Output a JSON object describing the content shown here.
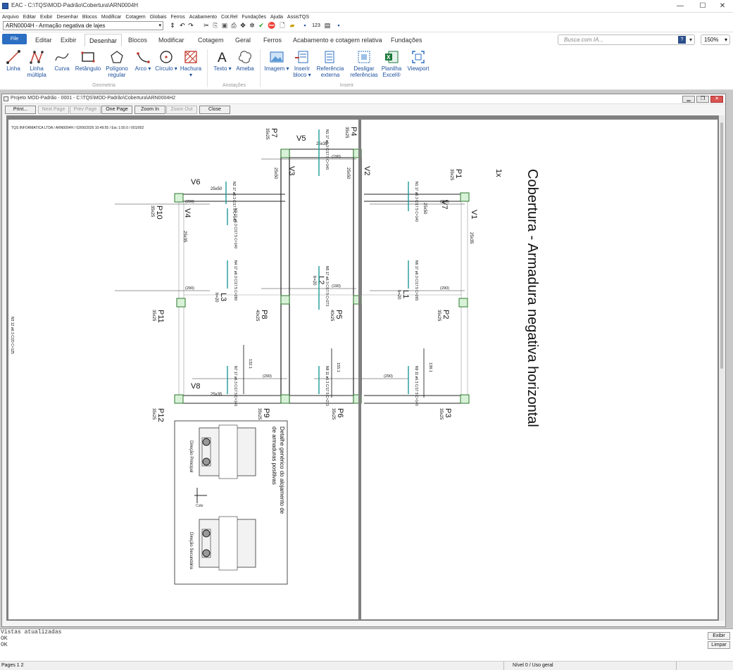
{
  "window": {
    "title": "EAC - C:\\TQS\\MOD-Padrão\\Cobertura\\ARN0004H",
    "controls": [
      "—",
      "☐",
      "✕"
    ]
  },
  "menu": [
    "Arquivo",
    "Editar",
    "Exibir",
    "Desenhar",
    "Blocos",
    "Modificar",
    "Cotagem",
    "Globais",
    "Ferros",
    "Acabamento",
    "Cot.Rel",
    "Fundações",
    "Ajuda",
    "AssisTQS"
  ],
  "quick_access": {
    "document": "ARN0004H - Armação negativa de lajes"
  },
  "tabs": {
    "file": "File",
    "items": [
      "Editar",
      "Exibir",
      "Desenhar",
      "Blocos",
      "Modificar",
      "Cotagem",
      "Geral",
      "Ferros",
      "Acabamento e cotagem relativa",
      "Fundações"
    ],
    "active": "Desenhar"
  },
  "search": {
    "placeholder": "Busca com IA...",
    "help": "?"
  },
  "zoom": "150%",
  "ribbon": {
    "buttons": [
      {
        "label": "Linha"
      },
      {
        "label": "Linha múltipla"
      },
      {
        "label": "Curva"
      },
      {
        "label": "Retângulo"
      },
      {
        "label": "Polígono regular"
      },
      {
        "label": "Arco ▾"
      },
      {
        "label": "Círculo ▾"
      },
      {
        "label": "Hachura ▾"
      },
      {
        "label": "Texto ▾"
      },
      {
        "label": "Ameba"
      },
      {
        "label": "Imagem ▾"
      },
      {
        "label": "Inserir bloco ▾"
      },
      {
        "label": "Referência externa"
      },
      {
        "label": "Desligar referências"
      },
      {
        "label": "Planilha Excel®"
      },
      {
        "label": "Viewport"
      }
    ],
    "groups": [
      "Geometria",
      "Anotações",
      "Inserir"
    ]
  },
  "child_window": {
    "title": "Projeto MOD-Padrão - 0001 - C:\\TQS\\MOD-Padrão\\Cobertura\\ARN0004H2",
    "toolbar": [
      "Print...",
      "Next Page",
      "Prev Page",
      "One Page",
      "Zoom In",
      "Zoom Out",
      "Close"
    ]
  },
  "drawing": {
    "header": "TQS INFORMATICA LTDA / ARN0004H / 02/06/2026 10:49:55 / Esc 1:50.0 / 001/002",
    "big_title": "Cobertura - Armadura negativa horizontal",
    "count": "1x",
    "side_note": "N3 12 ø6.3 C/20 C=125",
    "pillars": [
      {
        "name": "P1",
        "size": "35x25"
      },
      {
        "name": "P2",
        "size": "35x25"
      },
      {
        "name": "P3",
        "size": "35x25"
      },
      {
        "name": "P4",
        "size": "35x25"
      },
      {
        "name": "P5",
        "size": "40x25"
      },
      {
        "name": "P6",
        "size": "35x25"
      },
      {
        "name": "P7",
        "size": "35x25"
      },
      {
        "name": "P8",
        "size": "40x25"
      },
      {
        "name": "P9",
        "size": "35x25"
      },
      {
        "name": "P10",
        "size": "35x25"
      },
      {
        "name": "P11",
        "size": "35x25"
      },
      {
        "name": "P12",
        "size": "35x25"
      }
    ],
    "beams": [
      {
        "name": "V1",
        "size": "25x35"
      },
      {
        "name": "V2",
        "size": "25x50"
      },
      {
        "name": "V3",
        "size": "25x50"
      },
      {
        "name": "V4",
        "size": "25x35"
      },
      {
        "name": "V5",
        "size": "25x35"
      },
      {
        "name": "V6",
        "size": "25x50"
      },
      {
        "name": "V7",
        "size": "25x50"
      },
      {
        "name": "V8",
        "size": "25x35"
      }
    ],
    "slabs": [
      {
        "name": "L1",
        "h": "h=20"
      },
      {
        "name": "L2",
        "h": "h=20"
      },
      {
        "name": "L3",
        "h": "h=20"
      }
    ],
    "dims": [
      "(190)",
      "(290)",
      "(290)",
      "(190)",
      "(290)",
      "(290)",
      "(290)",
      "(290)"
    ],
    "rebar_labels": [
      "N1 17 ø6.3 C/17.5 C=140",
      "N2 17 ø6.3 C/17.5 C=140",
      "N4 17 ø6.3 C/17.5 C=280",
      "N5 17 ø6.3 C/17.5 C=273",
      "N6 17 ø6.3 C/17.5 C=265",
      "N7 17 ø6.3 C/17.5 C=140",
      "N8 11 ø6.3 C/17.5 C=273",
      "N9 11 ø6.3 C/17.5 C=140"
    ],
    "detail_title": "Detalhe genérico do alojamento de armaduras positivas",
    "detail_labels": [
      "Direção Principal",
      "Direção Secundária",
      "Cobr"
    ],
    "aux_dims": [
      "132.1",
      "155.1",
      "138.1"
    ]
  },
  "console": {
    "lines": [
      "Vistas atualizadas",
      "OK",
      "OK"
    ],
    "buttons": [
      "Exibir",
      "Limpar"
    ]
  },
  "status": {
    "left": "Pages 1 2",
    "center": "Nível 0 / Uso geral"
  }
}
